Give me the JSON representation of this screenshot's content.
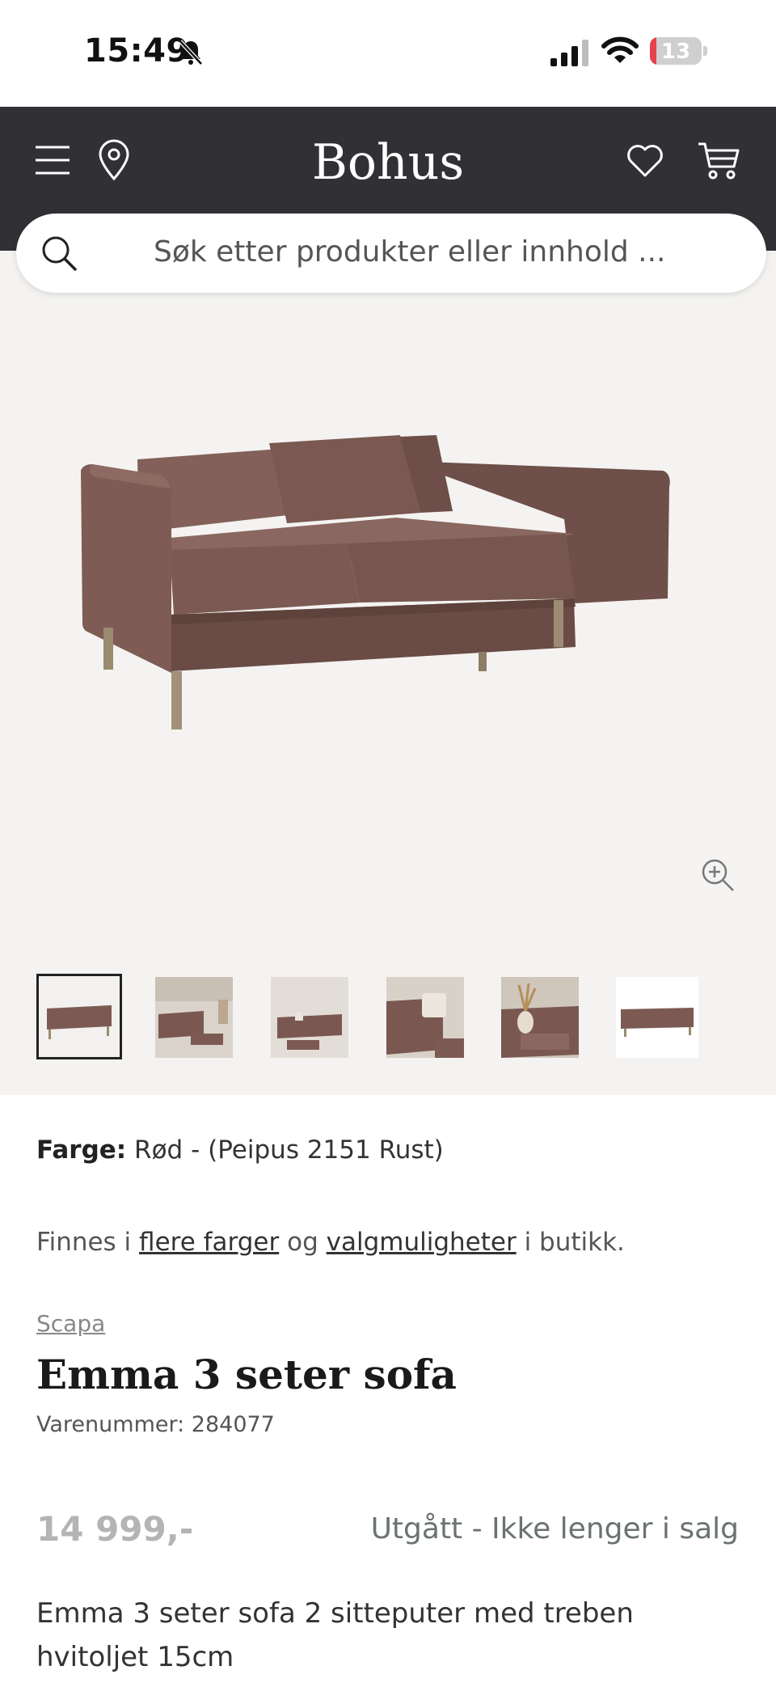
{
  "status_bar": {
    "time": "15:49",
    "battery": "13",
    "battery_level": 0.13
  },
  "header": {
    "logo": "Bohus",
    "icons": [
      "menu-icon",
      "location-icon",
      "heart-icon",
      "cart-icon"
    ]
  },
  "search": {
    "placeholder": "Søk etter produkter eller innhold ..."
  },
  "gallery": {
    "thumbnail_count": 6,
    "active_index": 0
  },
  "product": {
    "color_label": "Farge:",
    "color_value": "Rød - (Peipus 2151 Rust)",
    "finnes_prefix": "Finnes i",
    "link_colors": "flere farger",
    "finnes_mid": "og",
    "link_options": "valgmuligheter",
    "finnes_suffix": "i butikk.",
    "brand": "Scapa",
    "title": "Emma 3 seter sofa",
    "sku": "Varenummer: 284077",
    "price": "14 999,-",
    "availability": "Utgått - Ikke lenger i salg",
    "description": "Emma 3 seter sofa 2 sitteputer med treben hvitoljet 15cm"
  },
  "colors": {
    "header_bg": "#313135",
    "gallery_bg": "#f4f3f1",
    "sofa": "#7d5a52",
    "price": "#b4b4b4",
    "availability": "#6a7272"
  }
}
